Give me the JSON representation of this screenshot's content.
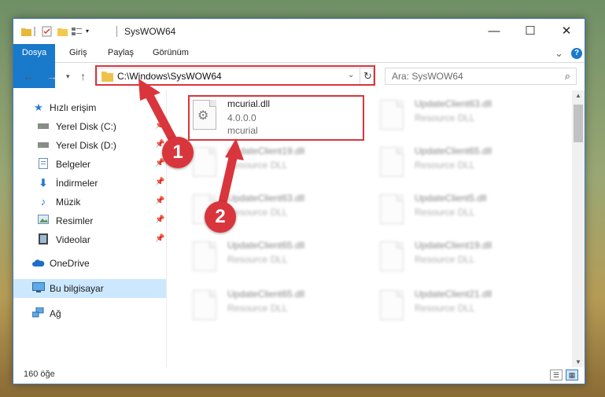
{
  "window": {
    "title": "SysWOW64",
    "minimize_glyph": "—",
    "maximize_glyph": "☐",
    "close_glyph": "✕"
  },
  "ribbon": {
    "tabs": [
      "Dosya",
      "Giriş",
      "Paylaş",
      "Görünüm"
    ],
    "expand_glyph": "⌄",
    "help_glyph": "?"
  },
  "address": {
    "path": "C:\\Windows\\SysWOW64",
    "search_placeholder": "Ara: SysWOW64"
  },
  "sidebar": {
    "items": [
      {
        "label": "Hızlı erişim",
        "icon": "star-icon",
        "pinned": false
      },
      {
        "label": "Yerel Disk (C:)",
        "icon": "drive-icon",
        "pinned": true
      },
      {
        "label": "Yerel Disk (D:)",
        "icon": "drive-icon",
        "pinned": true
      },
      {
        "label": "Belgeler",
        "icon": "documents-icon",
        "pinned": true
      },
      {
        "label": "İndirmeler",
        "icon": "download-icon",
        "pinned": true
      },
      {
        "label": "Müzik",
        "icon": "music-icon",
        "pinned": true
      },
      {
        "label": "Resimler",
        "icon": "pictures-icon",
        "pinned": true
      },
      {
        "label": "Videolar",
        "icon": "videos-icon",
        "pinned": true
      },
      {
        "label": "OneDrive",
        "icon": "cloud-icon",
        "pinned": false
      },
      {
        "label": "Bu bilgisayar",
        "icon": "computer-icon",
        "pinned": false,
        "selected": true
      },
      {
        "label": "Ağ",
        "icon": "network-icon",
        "pinned": false
      }
    ]
  },
  "files": {
    "highlighted": {
      "name": "mcurial.dll",
      "version": "4.0.0.0",
      "description": "mcurial"
    },
    "left_column": [
      {
        "name": "UpdateClient19.dll",
        "type": "Resource DLL"
      },
      {
        "name": "UpdateClient63.dll",
        "type": "Resource DLL"
      },
      {
        "name": "UpdateClient65.dll",
        "type": "Resource DLL"
      },
      {
        "name": "UpdateClient65.dll",
        "type": "Resource DLL"
      }
    ],
    "right_column": [
      {
        "name": "UpdateClient63.dll",
        "type": "Resource DLL"
      },
      {
        "name": "UpdateClient65.dll",
        "type": "Resource DLL"
      },
      {
        "name": "UpdateClient5.dll",
        "type": "Resource DLL"
      },
      {
        "name": "UpdateClient19.dll",
        "type": "Resource DLL"
      },
      {
        "name": "UpdateClient21.dll",
        "type": "Resource DLL"
      }
    ]
  },
  "status": {
    "count": "160 öğe"
  },
  "annotations": {
    "step1": "1",
    "step2": "2",
    "color": "#d9353d"
  }
}
